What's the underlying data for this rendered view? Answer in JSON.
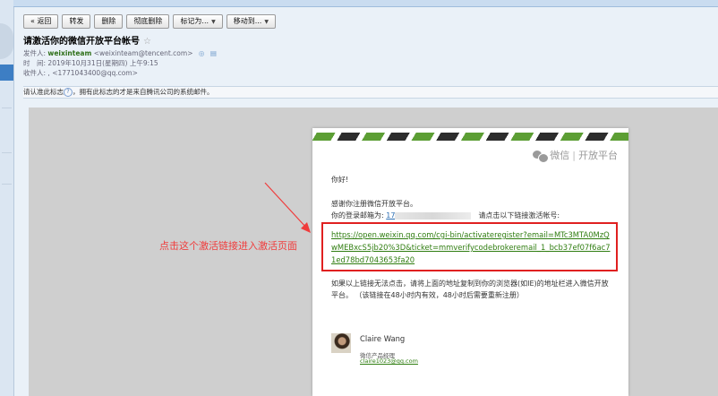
{
  "toolbar": {
    "back": "« 返回",
    "forward": "转发",
    "delete": "删除",
    "delete_permanent": "彻底删除",
    "mark_as": "标记为...",
    "move_to": "移动到..."
  },
  "header": {
    "subject": "请激活你的微信开放平台帐号",
    "star": "☆",
    "from_label": "发件人:",
    "from_name": "weixinteam",
    "from_addr": "<weixinteam@tencent.com>",
    "time_label": "时　间:",
    "time_value": "2019年10月31日(星期四) 上午9:15",
    "to_label": "收件人:",
    "to_value": ", <1771043400@qq.com>"
  },
  "notice": {
    "before": "请认准此标志",
    "after": "，拥有此标志的才是来自腾讯公司的系统邮件。"
  },
  "letter": {
    "logo_text": "微信",
    "logo_sub": "开放平台",
    "greeting": "你好!",
    "thanks": "感谢你注册微信开放平台。",
    "email_prefix": "你的登录邮箱为:",
    "email_visible": "17",
    "email_suffix": "请点击以下链接激活帐号:",
    "activation_link": "https://open.weixin.qq.com/cgi-bin/activateregister?email=MTc3MTA0MzQwMEBxcS5jb20%3D&ticket=mmverifycodebrokeremail_1_bcb37ef07f6ac71ed78bd7043653fa20",
    "note": "如果以上链接无法点击，请将上面的地址复制到你的浏览器(如IE)的地址栏进入微信开放平台。 （该链接在48小时内有效，48小时后需要重新注册）",
    "sig_name": "Claire Wang",
    "sig_title": "微信产品经理",
    "sig_mail": "claire1023@qq.com"
  },
  "annotation": "点击这个激活链接进入激活页面",
  "colors": {
    "annotation_red": "#f03c3c",
    "link_green": "#2f7d10",
    "stripe_green": "#5c9e34",
    "stripe_dark": "#2d2d2d"
  },
  "icons": [
    "search-icon",
    "qq-badge-icon",
    "calendar-icon",
    "question-icon",
    "wechat-logo-icon",
    "dropdown-arrow-icon"
  ]
}
